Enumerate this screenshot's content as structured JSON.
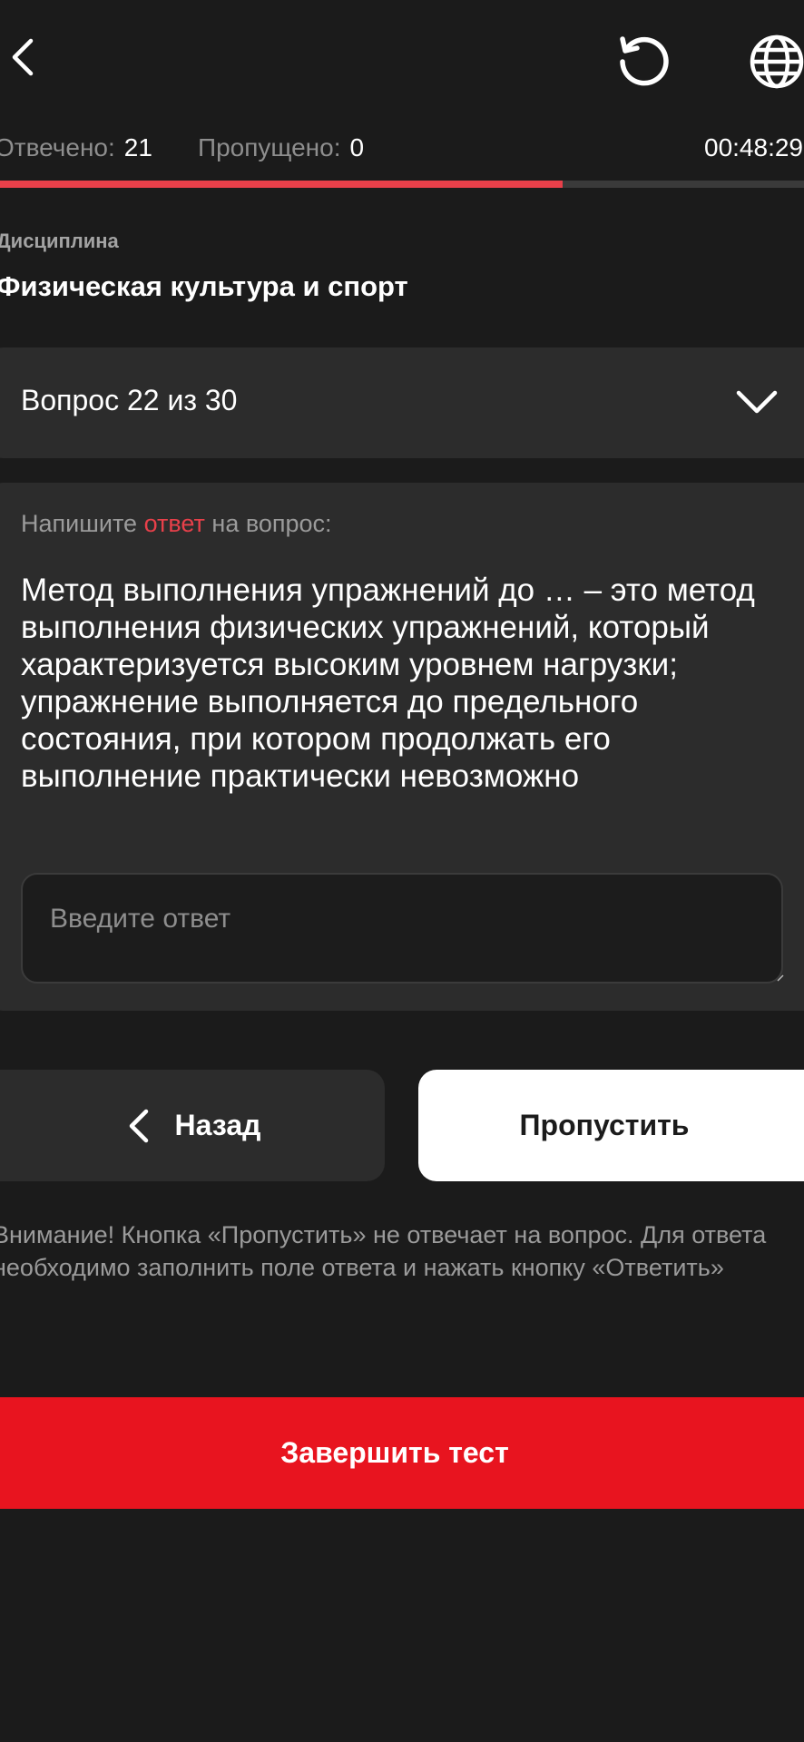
{
  "header": {
    "back_icon": "chevron-left-icon",
    "restart_icon": "restart-icon",
    "language_icon": "globe-icon"
  },
  "stats": {
    "answered_label": "Отвечено:",
    "answered_value": "21",
    "skipped_label": "Пропущено:",
    "skipped_value": "0",
    "timer": "00:48:29"
  },
  "progress": {
    "answered": 21,
    "total": 30,
    "fill_color": "#e8404a"
  },
  "discipline": {
    "label": "Дисциплина",
    "name": "Физическая культура и спорт"
  },
  "question_selector": {
    "label": "Вопрос 22 из 30",
    "icon": "chevron-down-icon"
  },
  "question": {
    "instruction_prefix": "Напишите",
    "instruction_accent": "ответ",
    "instruction_suffix": "на вопрос:",
    "text": "Метод выполнения упражнений до … – это метод выполнения физических упражнений, который характеризуется высоким уровнем нагрузки; упражнение выполняется до предельного состояния, при котором продолжать его выполнение практически невозможно",
    "answer_placeholder": "Введите ответ",
    "answer_value": ""
  },
  "buttons": {
    "back_label": "Назад",
    "skip_label": "Пропустить",
    "finish_label": "Завершить тест"
  },
  "notice": "Внимание! Кнопка «Пропустить» не отвечает на вопрос. Для ответа необходимо заполнить поле ответа и нажать кнопку «Ответить»",
  "colors": {
    "background": "#1b1b1b",
    "card": "#2c2c2c",
    "accent": "#e8404a",
    "finish_button": "#e8141f"
  }
}
